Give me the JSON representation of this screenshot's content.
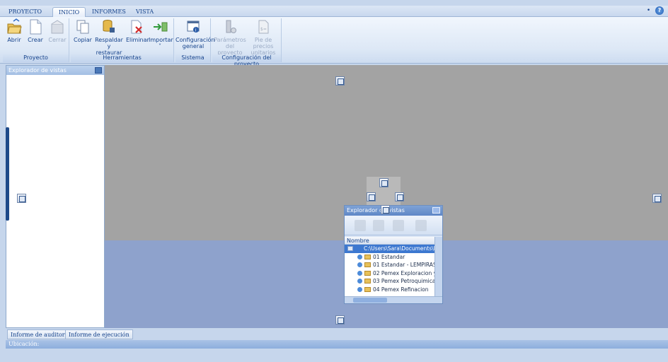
{
  "tabs": [
    {
      "label": "PROYECTO",
      "active": false
    },
    {
      "label": "INICIO",
      "active": true
    },
    {
      "label": "INFORMES",
      "active": false
    },
    {
      "label": "VISTA",
      "active": false
    }
  ],
  "help": {
    "pin": "•",
    "q": "?"
  },
  "ribbon": {
    "groups": [
      {
        "label": "Proyecto"
      },
      {
        "label": "Herramientas"
      },
      {
        "label": "Sistema"
      },
      {
        "label": "Configuración del proyecto"
      }
    ],
    "buttons": {
      "abrir": "Abrir",
      "crear": "Crear",
      "cerrar": "Cerrar",
      "copiar": "Copiar",
      "respaldar_1": "Respaldar y",
      "respaldar_2": "restaurar ˅",
      "eliminar": "Eliminar",
      "importar": "Importar",
      "importar_arrow": "˅",
      "config_1": "Configuración",
      "config_2": "general",
      "param_1": "Parámetros",
      "param_2": "del proyecto",
      "pie_1": "Pie de precios",
      "pie_2": "unitarios"
    }
  },
  "left_panel": {
    "title": "Explorador de vistas"
  },
  "float_window": {
    "title": "Explorador de vistas",
    "column": "Nombre",
    "root": "C:\\Users\\Sara\\Documents\\Ec",
    "items": [
      "01 Estandar",
      "01 Estandar - LEMPIRAS",
      "02 Pemex Exploracion y F",
      "03 Pemex Petroquimica",
      "04 Pemex Refinacion"
    ]
  },
  "bottom_tabs": [
    "Informe de auditoría",
    "Informe de ejecución"
  ],
  "status": {
    "location_label": "Ubicación:"
  }
}
